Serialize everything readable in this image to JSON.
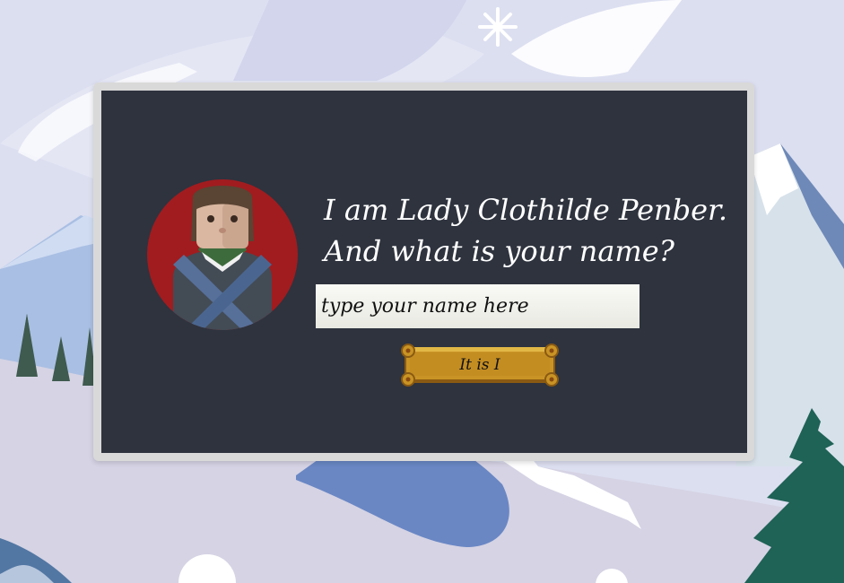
{
  "dialog": {
    "line1": "I am Lady Clothilde Penber.",
    "line2": "And what is your name?"
  },
  "name_input": {
    "placeholder": "type your name here",
    "value": ""
  },
  "submit_button": {
    "label": "It is I"
  },
  "colors": {
    "panel": "#2e333e",
    "frame": "#d9d9d9",
    "portrait_circle": "#a11c1f",
    "button_gold": "#c99425",
    "text": "#ffffff"
  },
  "icons": {
    "portrait": "lady-clothilde-portrait",
    "snowflake": "snowflake-icon"
  }
}
